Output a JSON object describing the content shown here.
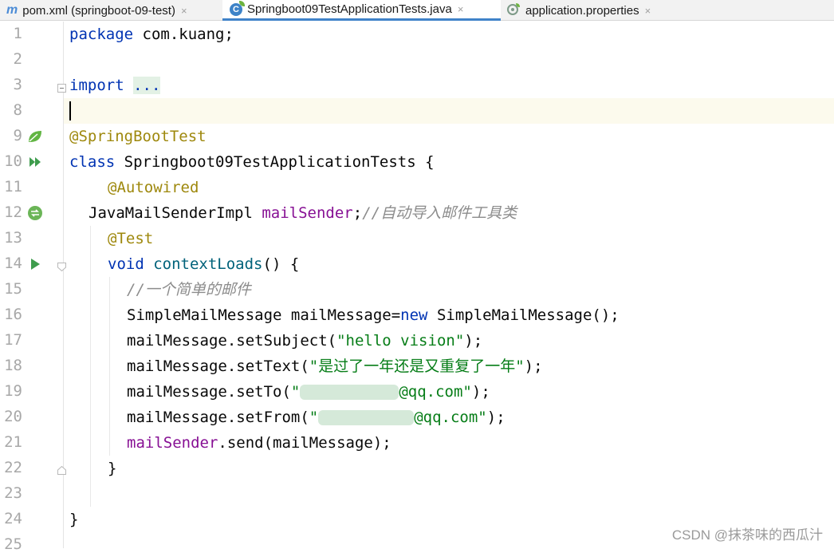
{
  "tabs": [
    {
      "icon": "maven-m-icon",
      "glyph": "m",
      "label": "pom.xml (springboot-09-test)",
      "close": "×",
      "active": false
    },
    {
      "icon": "spring-java-class-icon",
      "glyph": "C",
      "label": "Springboot09TestApplicationTests.java",
      "close": "×",
      "active": true
    },
    {
      "icon": "spring-properties-icon",
      "label": "application.properties",
      "close": "×",
      "active": false
    }
  ],
  "line_numbers": [
    "1",
    "2",
    "3",
    "8",
    "9",
    "10",
    "11",
    "12",
    "13",
    "14",
    "15",
    "16",
    "17",
    "18",
    "19",
    "20",
    "21",
    "22",
    "23",
    "24",
    "25"
  ],
  "code": {
    "l1_kw": "package",
    "l1_rest": " com.kuang;",
    "l3_kw": "import",
    "l3_fold": "...",
    "l9_ann": "@SpringBootTest",
    "l10_kw": "class",
    "l10_rest": " Springboot09TestApplicationTests {",
    "l11_ann": "@Autowired",
    "l12_type": "JavaMailSenderImpl ",
    "l12_field": "mailSender",
    "l12_semi": ";",
    "l12_cmt": "//自动导入邮件工具类",
    "l13_ann": "@Test",
    "l14_kw": "void",
    "l14_sp": " ",
    "l14_mth": "contextLoads",
    "l14_rest": "() {",
    "l15_cmt": "//一个简单的邮件",
    "l16_a": "SimpleMailMessage mailMessage=",
    "l16_kw": "new",
    "l16_b": " SimpleMailMessage();",
    "l17_a": "mailMessage.setSubject(",
    "l17_str": "\"hello vision\"",
    "l17_b": ");",
    "l18_a": "mailMessage.setText(",
    "l18_str": "\"是过了一年还是又重复了一年\"",
    "l18_b": ");",
    "l19_a": "mailMessage.setTo(",
    "l19_q": "\"",
    "l19_str": "@qq.com\"",
    "l19_b": ");",
    "l20_a": "mailMessage.setFrom(",
    "l20_q": "\"",
    "l20_str": "@qq.com\"",
    "l20_b": ");",
    "l21_field": "mailSender",
    "l21_rest": ".send(mailMessage);",
    "l22": "}",
    "l24": "}"
  },
  "watermark": "CSDN @抹茶味的西瓜汁",
  "colors": {
    "keyword": "#0033b3",
    "annotation": "#9e880d",
    "field": "#871094",
    "string": "#067d17",
    "comment": "#8c8c8c",
    "method": "#00627a",
    "tab_underline": "#4083c9",
    "caret_line": "#fcfaed"
  }
}
